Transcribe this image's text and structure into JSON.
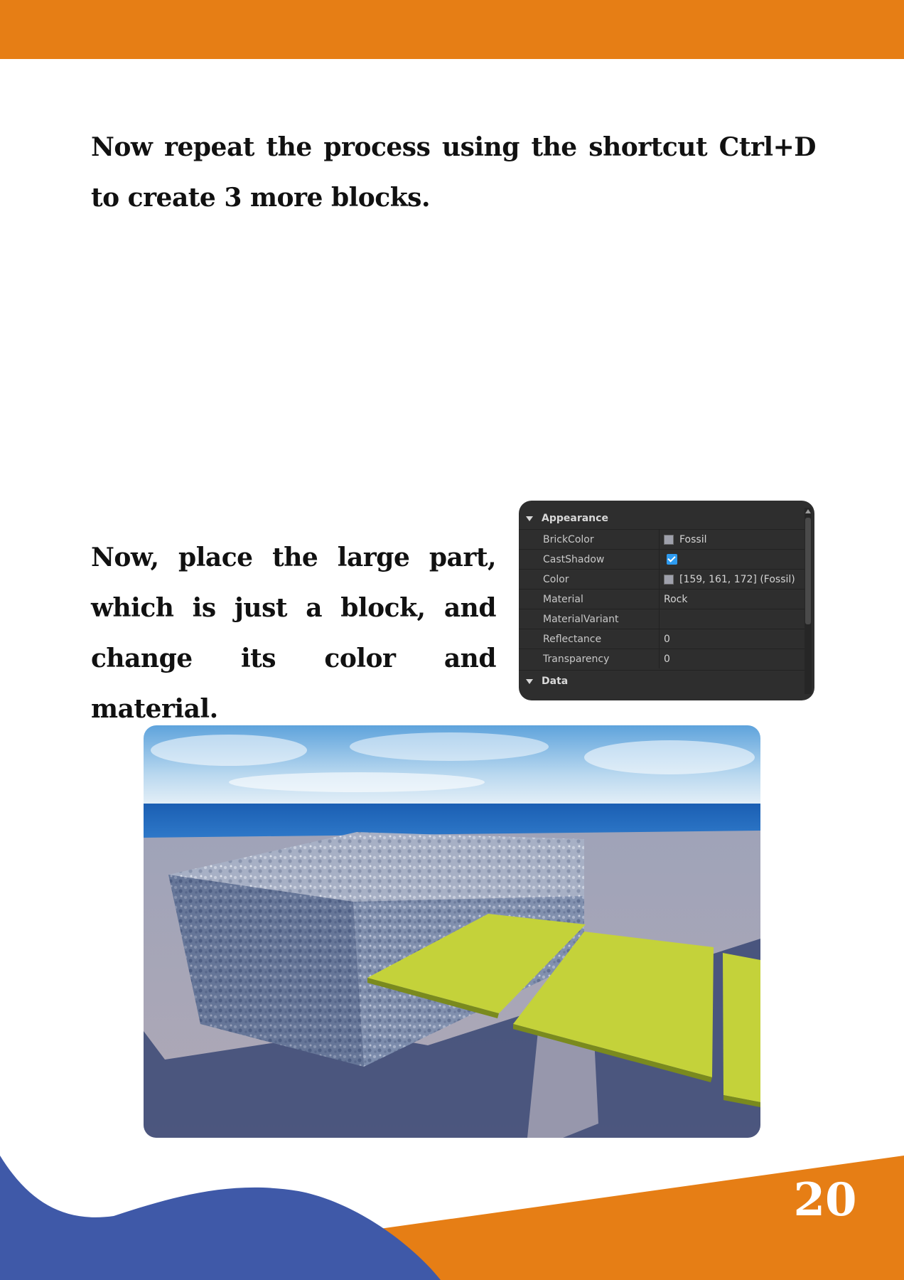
{
  "paragraphs": {
    "first": "Now repeat the process using the shortcut Ctrl+D to create 3 more blocks.",
    "second": "Now, place the large part, which is just a block, and change its color and material."
  },
  "properties_panel": {
    "section_appearance": "Appearance",
    "section_data": "Data",
    "rows": [
      {
        "name": "BrickColor",
        "value": "Fossil",
        "swatch": true
      },
      {
        "name": "CastShadow",
        "value": "",
        "checkbox": true,
        "checked": true
      },
      {
        "name": "Color",
        "value": "[159, 161, 172] (Fossil)",
        "swatch": true
      },
      {
        "name": "Material",
        "value": "Rock"
      },
      {
        "name": "MaterialVariant",
        "value": ""
      },
      {
        "name": "Reflectance",
        "value": "0"
      },
      {
        "name": "Transparency",
        "value": "0"
      }
    ],
    "swatch_color": "#9fa1ac",
    "checkbox_color": "#2d9bf0"
  },
  "scene": {
    "description_icon": "roblox-studio-viewport",
    "block_color": "#8f9bb5",
    "plate_color": "#c4d23a"
  },
  "page_number": "20",
  "colors": {
    "accent_orange": "#e67e15",
    "accent_blue": "#3f59a8"
  }
}
